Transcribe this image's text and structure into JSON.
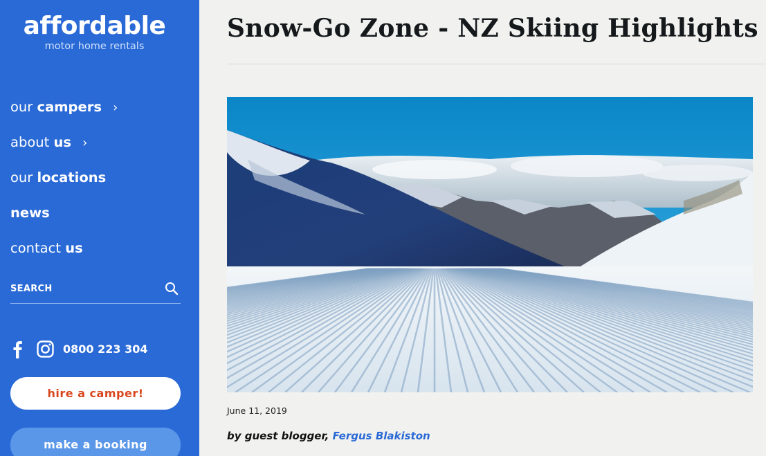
{
  "sidebar": {
    "logo": {
      "main": "affordable",
      "sub": "motor home rentals"
    },
    "nav": [
      {
        "pre": "our",
        "strong": "campers",
        "chevron": "›"
      },
      {
        "pre": "about",
        "strong": "us",
        "chevron": "›"
      },
      {
        "pre": "our",
        "strong": "locations"
      },
      {
        "pre": "",
        "strong": "news"
      },
      {
        "pre": "contact",
        "strong": "us"
      }
    ],
    "search": {
      "label": "SEARCH",
      "icon": "search-icon"
    },
    "social": {
      "facebook_icon": "facebook-icon",
      "instagram_icon": "instagram-icon",
      "phone": "0800 223 304"
    },
    "buttons": {
      "hire": "hire a camper!",
      "booking": "make a booking"
    }
  },
  "article": {
    "title": "Snow-Go Zone - NZ Skiing Highlights",
    "date": "June 11, 2019",
    "byline_prefix": "by guest blogger, ",
    "author": "Fergus Blakiston"
  },
  "colors": {
    "sidebar_bg": "#2a6ad6",
    "hire_text": "#d9461d",
    "booking_bg": "#5a97e8",
    "link": "#2a6ad6"
  }
}
